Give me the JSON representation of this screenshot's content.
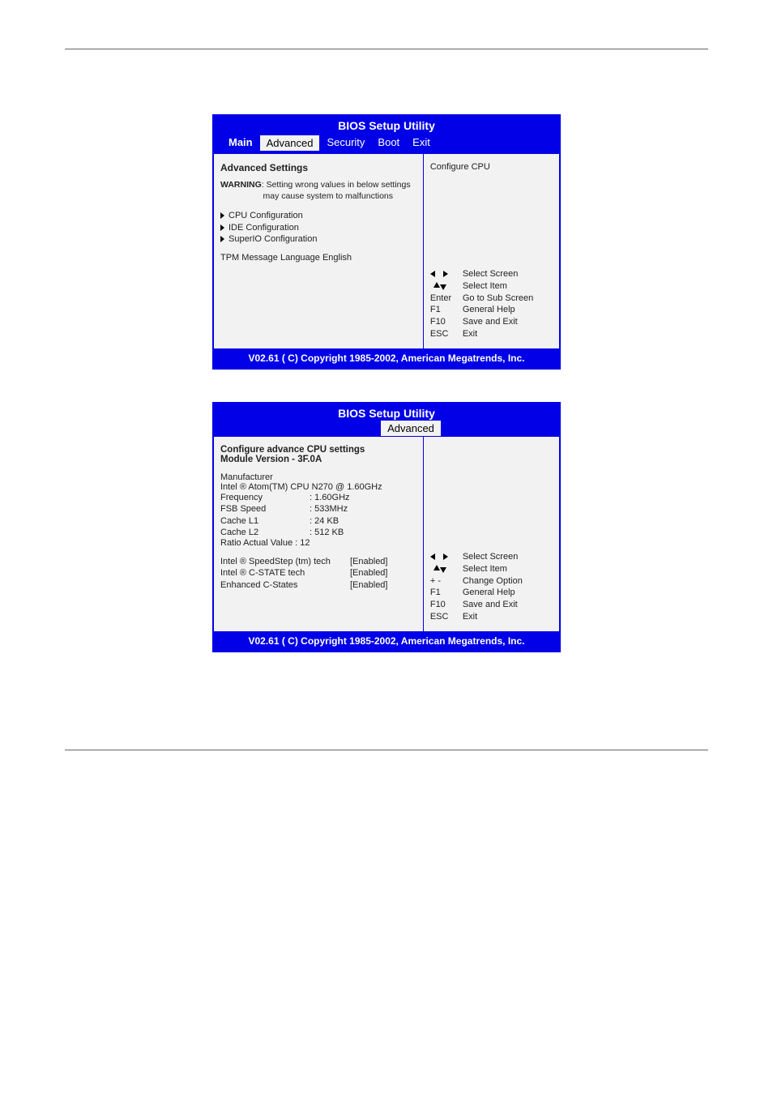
{
  "bios_title": "BIOS Setup Utility",
  "tabs": {
    "main": "Main",
    "advanced": "Advanced",
    "security": "Security",
    "boot": "Boot",
    "exit": "Exit"
  },
  "screen1": {
    "heading": "Advanced Settings",
    "warning_label": "WARNING",
    "warning_text1": ": Setting wrong values in below settings",
    "warning_text2": "may cause system to malfunctions",
    "menu": {
      "cpu": "CPU Configuration",
      "ide": "IDE Configuration",
      "superio": "SuperIO Configuration"
    },
    "tpm_line": "TPM Message Language   English",
    "help_text": "Configure CPU",
    "legend": {
      "lr": "Select Screen",
      "ud": "Select Item",
      "enter_key": "Enter",
      "enter": "Go to Sub Screen",
      "f1_key": "F1",
      "f1": "General Help",
      "f10_key": "F10",
      "f10": "Save and Exit",
      "esc_key": "ESC",
      "esc": "Exit"
    }
  },
  "screen2": {
    "heading1": "Configure advance CPU settings",
    "heading2": "Module Version - 3F.0A",
    "info": {
      "manufacturer_label": "Manufacturer",
      "cpu_line": "Intel ® Atom(TM) CPU N270    @ 1.60GHz",
      "freq_label": "Frequency",
      "freq_val": ": 1.60GHz",
      "fsb_label": "FSB Speed",
      "fsb_val": ": 533MHz",
      "l1_label": "Cache L1",
      "l1_val": ": 24 KB",
      "l2_label": "Cache L2",
      "l2_val": ": 512 KB",
      "ratio_line": "Ratio Actual Value : 12"
    },
    "options": {
      "speedstep_label": "Intel ® SpeedStep (tm) tech",
      "speedstep_val": "[Enabled]",
      "cstate_label": "Intel ® C-STATE tech",
      "cstate_val": "[Enabled]",
      "enhc_label": "Enhanced C-States",
      "enhc_val": "[Enabled]"
    },
    "legend": {
      "lr": "Select Screen",
      "ud": "Select Item",
      "pm_key": "+ -",
      "pm": "Change Option",
      "f1_key": "F1",
      "f1": "General Help",
      "f10_key": "F10",
      "f10": "Save and Exit",
      "esc_key": "ESC",
      "esc": "Exit"
    }
  },
  "footer": "V02.61  ( C) Copyright 1985-2002, American Megatrends, Inc."
}
